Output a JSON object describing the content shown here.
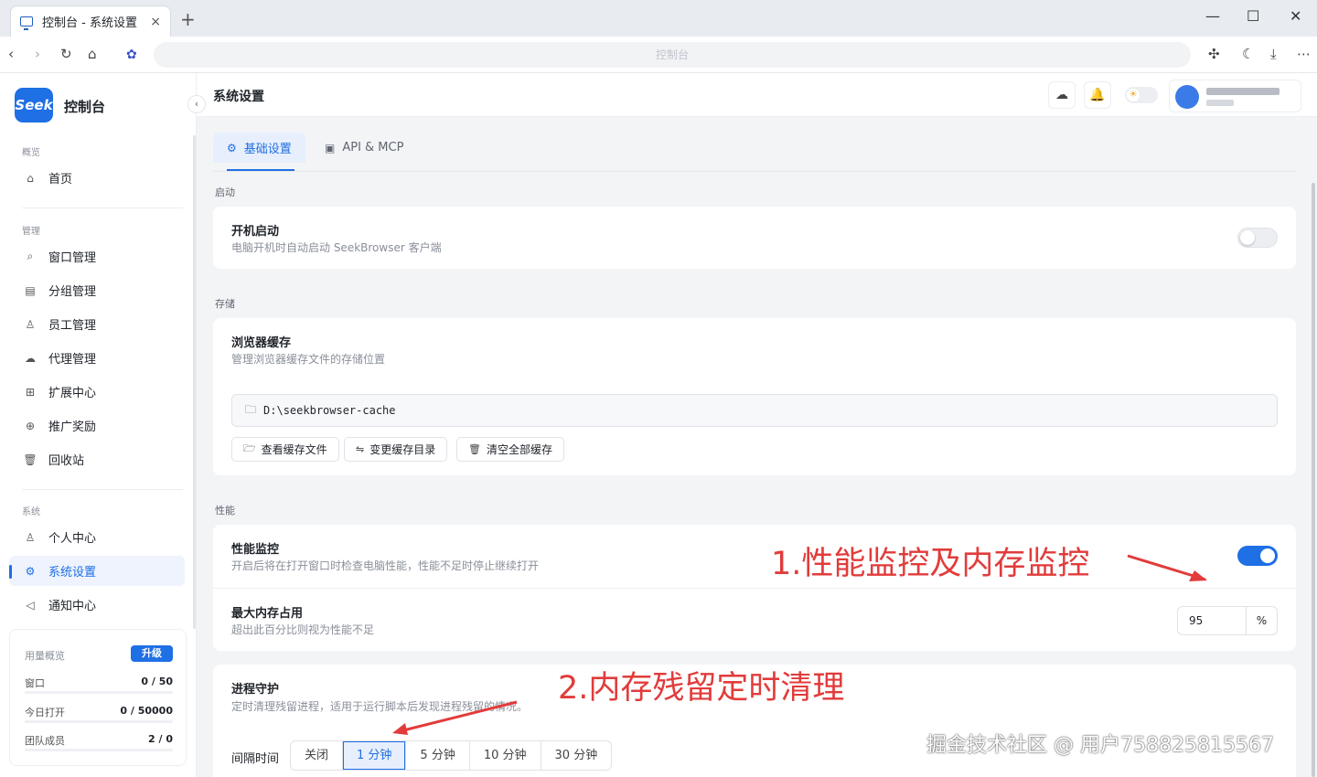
{
  "browser": {
    "tab_title": "控制台 - 系统设置",
    "tab_close": "×",
    "new_tab": "+",
    "url_text": "控制台",
    "window_controls": [
      "—",
      "☐",
      "✕"
    ]
  },
  "sidebar": {
    "logo_text": "Seek",
    "brand": "控制台",
    "collapse_glyph": "‹",
    "sections": {
      "overview": "概览",
      "manage": "管理",
      "system": "系统"
    },
    "items": [
      {
        "label": "首页",
        "icon": "⌂"
      },
      {
        "label": "窗口管理",
        "icon": "⌕"
      },
      {
        "label": "分组管理",
        "icon": "▤"
      },
      {
        "label": "员工管理",
        "icon": "♙"
      },
      {
        "label": "代理管理",
        "icon": "☁"
      },
      {
        "label": "扩展中心",
        "icon": "⊞"
      },
      {
        "label": "推广奖励",
        "icon": "⊕"
      },
      {
        "label": "回收站",
        "icon": "🗑"
      },
      {
        "label": "个人中心",
        "icon": "♙"
      },
      {
        "label": "系统设置",
        "icon": "⚙"
      },
      {
        "label": "通知中心",
        "icon": "◁"
      }
    ],
    "usage": {
      "title": "用量概览",
      "upgrade": "升级",
      "rows": [
        {
          "label": "窗口",
          "used": "0",
          "total": "50"
        },
        {
          "label": "今日打开",
          "used": "0",
          "total": "50000"
        },
        {
          "label": "团队成员",
          "used": "2",
          "total": "0"
        }
      ]
    }
  },
  "header": {
    "title": "系统设置"
  },
  "tabs": [
    {
      "label": "基础设置",
      "icon": "⚙"
    },
    {
      "label": "API & MCP",
      "icon": "▣"
    }
  ],
  "startup": {
    "group": "启动",
    "title": "开机启动",
    "desc": "电脑开机时自动启动 SeekBrowser 客户端",
    "enabled": false
  },
  "storage": {
    "group": "存储",
    "title": "浏览器缓存",
    "desc": "管理浏览器缓存文件的存储位置",
    "path": "D:\\seekbrowser-cache",
    "buttons": [
      {
        "label": "查看缓存文件",
        "icon": "🗁"
      },
      {
        "label": "变更缓存目录",
        "icon": "⇋"
      },
      {
        "label": "清空全部缓存",
        "icon": "🗑"
      }
    ]
  },
  "performance": {
    "group": "性能",
    "monitor_title": "性能监控",
    "monitor_desc": "开启后将在打开窗口时检查电脑性能，性能不足时停止继续打开",
    "monitor_enabled": true,
    "mem_title": "最大内存占用",
    "mem_desc": "超出此百分比则视为性能不足",
    "mem_value": "95",
    "mem_unit": "%"
  },
  "process_guard": {
    "title": "进程守护",
    "desc": "定时清理残留进程，适用于运行脚本后发现进程残留的情况。",
    "interval_label": "间隔时间",
    "options": [
      "关闭",
      "1 分钟",
      "5 分钟",
      "10 分钟",
      "30 分钟"
    ],
    "selected": "1 分钟"
  },
  "annotations": {
    "a1": "1.性能监控及内存监控",
    "a2": "2.内存残留定时清理",
    "color": "#e23b3b"
  },
  "watermark": "掘金技术社区 @ 用户758825815567"
}
